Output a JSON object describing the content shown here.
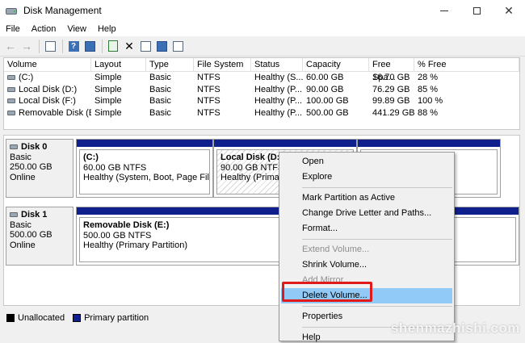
{
  "window": {
    "title": "Disk Management",
    "controls": {
      "minimize": "",
      "maximize": "",
      "close": "✕"
    }
  },
  "menu": [
    "File",
    "Action",
    "View",
    "Help"
  ],
  "toolbar": {
    "icons": [
      "back-arrow-icon",
      "forward-arrow-icon",
      "show-hide-console-tree-icon",
      "help-icon",
      "properties-icon",
      "refresh-icon",
      "delete-icon",
      "rescan-icon",
      "search-icon",
      "export-icon"
    ]
  },
  "volume_list": {
    "columns": [
      "Volume",
      "Layout",
      "Type",
      "File System",
      "Status",
      "Capacity",
      "Free Spa...",
      "% Free"
    ],
    "rows": [
      [
        "(C:)",
        "Simple",
        "Basic",
        "NTFS",
        "Healthy (S...",
        "60.00 GB",
        "16.70 GB",
        "28 %"
      ],
      [
        "Local Disk (D:)",
        "Simple",
        "Basic",
        "NTFS",
        "Healthy (P...",
        "90.00 GB",
        "76.29 GB",
        "85 %"
      ],
      [
        "Local Disk (F:)",
        "Simple",
        "Basic",
        "NTFS",
        "Healthy (P...",
        "100.00 GB",
        "99.89 GB",
        "100 %"
      ],
      [
        "Removable Disk (E:)",
        "Simple",
        "Basic",
        "NTFS",
        "Healthy (P...",
        "500.00 GB",
        "441.29 GB",
        "88 %"
      ]
    ]
  },
  "disks": [
    {
      "name": "Disk 0",
      "type": "Basic",
      "size": "250.00 GB",
      "status": "Online",
      "partitions": [
        {
          "name": "(C:)",
          "size": "60.00 GB NTFS",
          "status": "Healthy (System, Boot, Page File, Ac"
        },
        {
          "name": "Local Disk  (D:)",
          "size": "90.00 GB NTFS",
          "status": "Healthy (Primary"
        },
        {
          "name": "",
          "size": "",
          "status": ""
        }
      ]
    },
    {
      "name": "Disk 1",
      "type": "Basic",
      "size": "500.00 GB",
      "status": "Online",
      "partitions": [
        {
          "name": "Removable Disk  (E:)",
          "size": "500.00 GB NTFS",
          "status": "Healthy (Primary Partition)"
        }
      ]
    }
  ],
  "legend": {
    "unallocated": "Unallocated",
    "primary": "Primary partition"
  },
  "context_menu": {
    "items": [
      {
        "label": "Open",
        "enabled": true
      },
      {
        "label": "Explore",
        "enabled": true
      },
      {
        "label": "Mark Partition as Active",
        "enabled": true
      },
      {
        "label": "Change Drive Letter and Paths...",
        "enabled": true
      },
      {
        "label": "Format...",
        "enabled": true
      },
      {
        "label": "Extend Volume...",
        "enabled": false
      },
      {
        "label": "Shrink Volume...",
        "enabled": true
      },
      {
        "label": "Add Mirror...",
        "enabled": false
      },
      {
        "label": "Delete Volume...",
        "enabled": true,
        "highlighted": true
      },
      {
        "label": "Properties",
        "enabled": true
      },
      {
        "label": "Help",
        "enabled": true
      }
    ]
  },
  "watermark": "shenmazhishi.com",
  "colors": {
    "primary_partition": "#0f1f8c",
    "highlight": "#91c9f7",
    "callout": "#e0191b"
  }
}
